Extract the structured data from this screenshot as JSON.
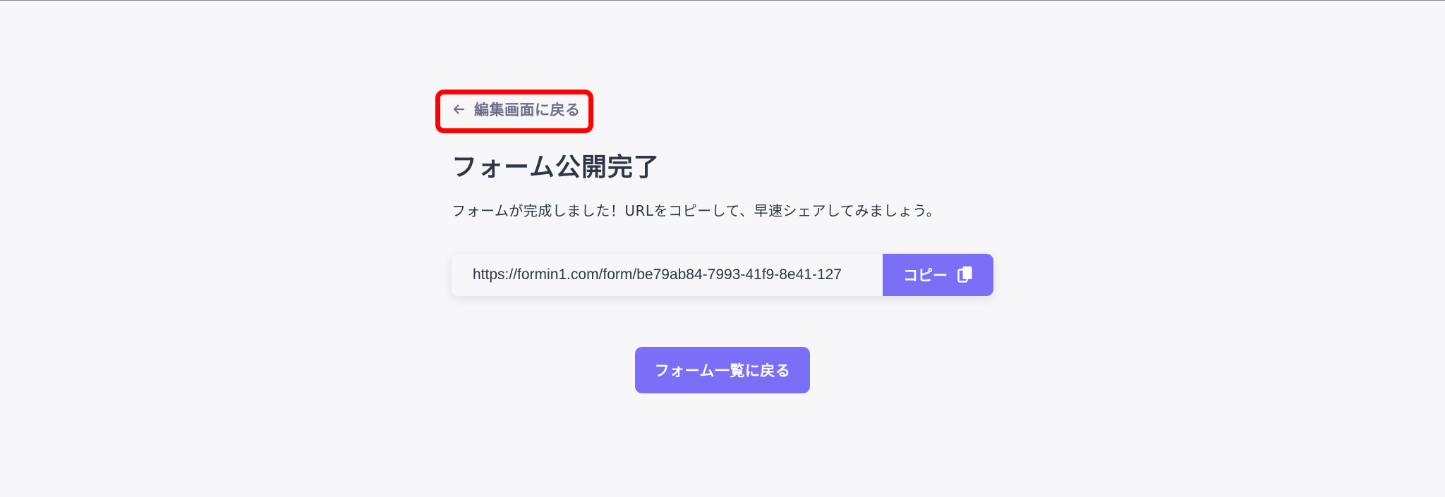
{
  "nav": {
    "back_label": "編集画面に戻る",
    "back_icon": "arrow-left-icon"
  },
  "page": {
    "title": "フォーム公開完了",
    "description": "フォームが完成しました！URLをコピーして、早速シェアしてみましょう。"
  },
  "share": {
    "url_value": "https://formin1.com/form/be79ab84-7993-41f9-8e41-127",
    "copy_label": "コピー",
    "copy_icon": "copy-icon"
  },
  "footer": {
    "list_button_label": "フォーム一覧に戻る"
  },
  "colors": {
    "background": "#f7f7f9",
    "accent": "#7c6ff7",
    "highlight": "#ff0000",
    "text": "#2d3748",
    "muted": "#6b6f8a"
  }
}
